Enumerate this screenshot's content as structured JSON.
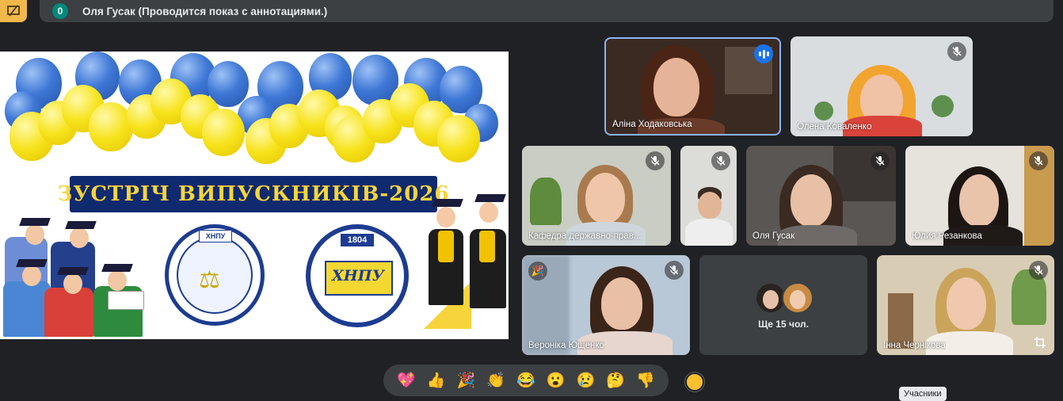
{
  "topbar": {
    "presenting_icon": "presentation-cancel-icon",
    "count": "0",
    "presenter_text": "Оля Гусак (Проводится показ с аннотациями.)"
  },
  "slide": {
    "banner": "ЗУСТРІЧ ВИПУСКНИКІВ-2026",
    "seal_left_code": "ХНПУ",
    "seal_right_year": "1804",
    "seal_right_abbr": "ХНПУ"
  },
  "participants": [
    {
      "name": "Аліна Ходаковська",
      "status": "speaking"
    },
    {
      "name": "Олена Коваленко",
      "status": "muted"
    },
    {
      "name": "Кафедра державно-прав...",
      "status": "muted"
    },
    {
      "name": "",
      "status": "muted"
    },
    {
      "name": "Оля Гусак",
      "status": "muted"
    },
    {
      "name": "Юлия Резанкова",
      "status": "muted"
    },
    {
      "name": "Вероніка Ющенко",
      "status": "muted"
    },
    {
      "name": "Інна Чернікова",
      "status": "muted"
    }
  ],
  "more_tile": {
    "label": "Ще 15 чол."
  },
  "reactions": [
    "💖",
    "👍",
    "🎉",
    "👏",
    "😂",
    "😮",
    "😢",
    "🤔",
    "👎"
  ],
  "tooltip": "Учасники",
  "colors": {
    "background": "#202124",
    "tile": "#3c4043",
    "speaking": "#8ab4f8",
    "accent": "#f2b84b",
    "badge": "#00897b"
  }
}
